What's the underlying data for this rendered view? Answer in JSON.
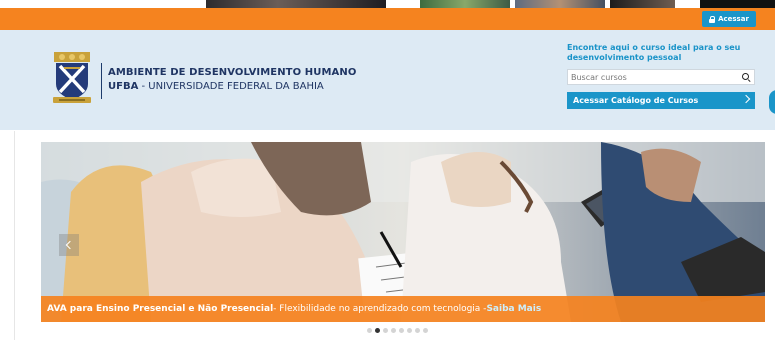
{
  "topbar": {
    "login_label": "Acessar"
  },
  "header": {
    "institution_line1": "AMBIENTE DE DESENVOLVIMENTO HUMANO",
    "institution_line2_bold": "UFBA",
    "institution_line2_rest": " - UNIVERSIDADE FEDERAL DA BAHIA",
    "find_course_text": "Encontre aqui o curso ideal para o seu desenvolvimento pessoal",
    "search": {
      "placeholder": "Buscar cursos"
    },
    "catalog_button_label": "Acessar Catálogo de Cursos"
  },
  "slider": {
    "caption_title": "AVA para Ensino Presencial e Não Presencial",
    "caption_text": " - Flexibilidade no aprendizado com tecnologia - ",
    "caption_link": "Saiba Mais",
    "active_slide": 1,
    "total_slides": 8
  },
  "colors": {
    "accent_orange": "#f5831f",
    "accent_blue": "#1a95c9",
    "header_bg": "#ddeaf4",
    "brand_navy": "#1f3563"
  }
}
